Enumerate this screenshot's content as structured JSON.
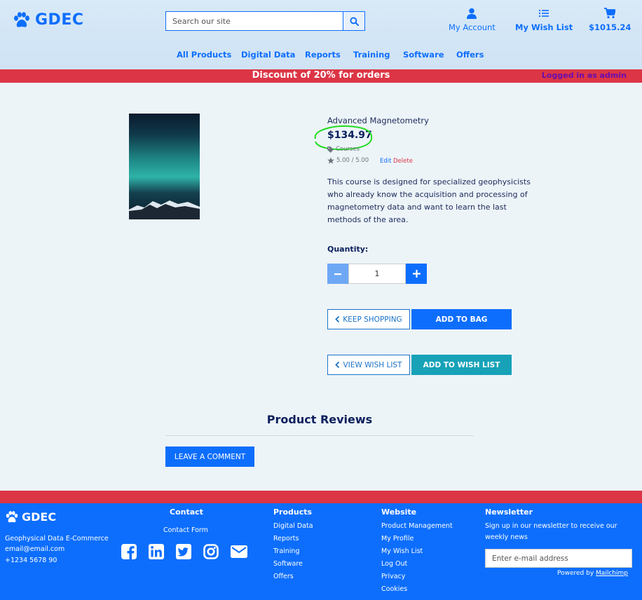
{
  "brand": {
    "name": "GDEC"
  },
  "search": {
    "placeholder": "Search our site"
  },
  "header_links": {
    "account": "My Account",
    "wishlist": "My Wish List",
    "bag_total": "$1015.24"
  },
  "nav": [
    "All Products",
    "Digital Data",
    "Reports",
    "Training",
    "Software",
    "Offers"
  ],
  "banner": {
    "message": "Discount of 20% for orders",
    "login_status": "Logged in as admin"
  },
  "product": {
    "name": "Advanced Magnetometry",
    "price": "$134.97",
    "category": "Courses",
    "rating": "5.00 / 5.00",
    "edit_label": "Edit",
    "delete_label": "Delete",
    "description": "This course is designed for specialized geophysicists who already know the acquisition and processing of magnetometry data and want to learn the last methods of the area.",
    "quantity_label": "Quantity:",
    "quantity_value": "1"
  },
  "actions": {
    "keep_shopping": "KEEP SHOPPING",
    "add_to_bag": "ADD TO BAG",
    "view_wish_list": "VIEW WISH LIST",
    "add_to_wish_list": "ADD TO WISH LIST"
  },
  "reviews": {
    "title": "Product Reviews",
    "comment_button": "LEAVE A COMMENT"
  },
  "footer": {
    "brand": "GDEC",
    "company": "Geophysical Data E-Commerce",
    "email": "email@email.com",
    "phone": "+1234 5678 90",
    "contact": {
      "heading": "Contact",
      "form_link": "Contact Form"
    },
    "products": {
      "heading": "Products",
      "links": [
        "Digital Data",
        "Reports",
        "Training",
        "Software",
        "Offers"
      ]
    },
    "website": {
      "heading": "Website",
      "links": [
        "Product Management",
        "My Profile",
        "My Wish List",
        "Log Out",
        "Privacy",
        "Cookies"
      ]
    },
    "newsletter": {
      "heading": "Newsletter",
      "text_line1": "Sign up in our newsletter to receive our",
      "text_line2": "weekly news",
      "placeholder": "Enter e-mail address",
      "powered_prefix": "Powered by",
      "powered_link": "Mailchimp"
    }
  },
  "colors": {
    "primary": "#0d6efd",
    "danger": "#dc3545",
    "info": "#17a2b8",
    "highlight": "#22dd22"
  }
}
